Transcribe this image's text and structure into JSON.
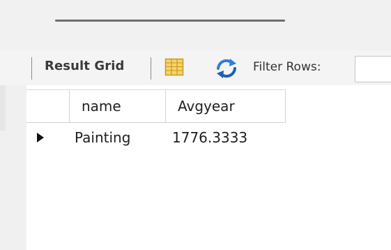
{
  "toolbar": {
    "result_grid_label": "Result Grid",
    "form_editor_icon": "form-editor-icon",
    "refresh_icon": "refresh-icon",
    "filter_label": "Filter Rows:",
    "filter_value": "",
    "filter_placeholder": ""
  },
  "grid": {
    "columns": [
      "name",
      "Avgyear"
    ],
    "rows": [
      {
        "selected": true,
        "cells": [
          "Painting",
          "1776.3333"
        ]
      }
    ]
  },
  "colors": {
    "header_bg": "#f1f1f1",
    "grid_border": "#d5d5d5",
    "form_icon_yellow": "#f2c94c",
    "refresh_blue": "#2e7bd6"
  }
}
